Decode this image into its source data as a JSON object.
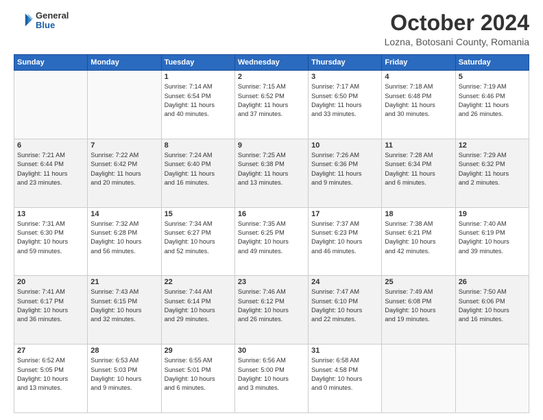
{
  "header": {
    "logo": {
      "general": "General",
      "blue": "Blue"
    },
    "title": "October 2024",
    "subtitle": "Lozna, Botosani County, Romania"
  },
  "calendar": {
    "headers": [
      "Sunday",
      "Monday",
      "Tuesday",
      "Wednesday",
      "Thursday",
      "Friday",
      "Saturday"
    ],
    "rows": [
      {
        "shaded": false,
        "cells": [
          {
            "day": "",
            "info": ""
          },
          {
            "day": "",
            "info": ""
          },
          {
            "day": "1",
            "info": "Sunrise: 7:14 AM\nSunset: 6:54 PM\nDaylight: 11 hours\nand 40 minutes."
          },
          {
            "day": "2",
            "info": "Sunrise: 7:15 AM\nSunset: 6:52 PM\nDaylight: 11 hours\nand 37 minutes."
          },
          {
            "day": "3",
            "info": "Sunrise: 7:17 AM\nSunset: 6:50 PM\nDaylight: 11 hours\nand 33 minutes."
          },
          {
            "day": "4",
            "info": "Sunrise: 7:18 AM\nSunset: 6:48 PM\nDaylight: 11 hours\nand 30 minutes."
          },
          {
            "day": "5",
            "info": "Sunrise: 7:19 AM\nSunset: 6:46 PM\nDaylight: 11 hours\nand 26 minutes."
          }
        ]
      },
      {
        "shaded": true,
        "cells": [
          {
            "day": "6",
            "info": "Sunrise: 7:21 AM\nSunset: 6:44 PM\nDaylight: 11 hours\nand 23 minutes."
          },
          {
            "day": "7",
            "info": "Sunrise: 7:22 AM\nSunset: 6:42 PM\nDaylight: 11 hours\nand 20 minutes."
          },
          {
            "day": "8",
            "info": "Sunrise: 7:24 AM\nSunset: 6:40 PM\nDaylight: 11 hours\nand 16 minutes."
          },
          {
            "day": "9",
            "info": "Sunrise: 7:25 AM\nSunset: 6:38 PM\nDaylight: 11 hours\nand 13 minutes."
          },
          {
            "day": "10",
            "info": "Sunrise: 7:26 AM\nSunset: 6:36 PM\nDaylight: 11 hours\nand 9 minutes."
          },
          {
            "day": "11",
            "info": "Sunrise: 7:28 AM\nSunset: 6:34 PM\nDaylight: 11 hours\nand 6 minutes."
          },
          {
            "day": "12",
            "info": "Sunrise: 7:29 AM\nSunset: 6:32 PM\nDaylight: 11 hours\nand 2 minutes."
          }
        ]
      },
      {
        "shaded": false,
        "cells": [
          {
            "day": "13",
            "info": "Sunrise: 7:31 AM\nSunset: 6:30 PM\nDaylight: 10 hours\nand 59 minutes."
          },
          {
            "day": "14",
            "info": "Sunrise: 7:32 AM\nSunset: 6:28 PM\nDaylight: 10 hours\nand 56 minutes."
          },
          {
            "day": "15",
            "info": "Sunrise: 7:34 AM\nSunset: 6:27 PM\nDaylight: 10 hours\nand 52 minutes."
          },
          {
            "day": "16",
            "info": "Sunrise: 7:35 AM\nSunset: 6:25 PM\nDaylight: 10 hours\nand 49 minutes."
          },
          {
            "day": "17",
            "info": "Sunrise: 7:37 AM\nSunset: 6:23 PM\nDaylight: 10 hours\nand 46 minutes."
          },
          {
            "day": "18",
            "info": "Sunrise: 7:38 AM\nSunset: 6:21 PM\nDaylight: 10 hours\nand 42 minutes."
          },
          {
            "day": "19",
            "info": "Sunrise: 7:40 AM\nSunset: 6:19 PM\nDaylight: 10 hours\nand 39 minutes."
          }
        ]
      },
      {
        "shaded": true,
        "cells": [
          {
            "day": "20",
            "info": "Sunrise: 7:41 AM\nSunset: 6:17 PM\nDaylight: 10 hours\nand 36 minutes."
          },
          {
            "day": "21",
            "info": "Sunrise: 7:43 AM\nSunset: 6:15 PM\nDaylight: 10 hours\nand 32 minutes."
          },
          {
            "day": "22",
            "info": "Sunrise: 7:44 AM\nSunset: 6:14 PM\nDaylight: 10 hours\nand 29 minutes."
          },
          {
            "day": "23",
            "info": "Sunrise: 7:46 AM\nSunset: 6:12 PM\nDaylight: 10 hours\nand 26 minutes."
          },
          {
            "day": "24",
            "info": "Sunrise: 7:47 AM\nSunset: 6:10 PM\nDaylight: 10 hours\nand 22 minutes."
          },
          {
            "day": "25",
            "info": "Sunrise: 7:49 AM\nSunset: 6:08 PM\nDaylight: 10 hours\nand 19 minutes."
          },
          {
            "day": "26",
            "info": "Sunrise: 7:50 AM\nSunset: 6:06 PM\nDaylight: 10 hours\nand 16 minutes."
          }
        ]
      },
      {
        "shaded": false,
        "cells": [
          {
            "day": "27",
            "info": "Sunrise: 6:52 AM\nSunset: 5:05 PM\nDaylight: 10 hours\nand 13 minutes."
          },
          {
            "day": "28",
            "info": "Sunrise: 6:53 AM\nSunset: 5:03 PM\nDaylight: 10 hours\nand 9 minutes."
          },
          {
            "day": "29",
            "info": "Sunrise: 6:55 AM\nSunset: 5:01 PM\nDaylight: 10 hours\nand 6 minutes."
          },
          {
            "day": "30",
            "info": "Sunrise: 6:56 AM\nSunset: 5:00 PM\nDaylight: 10 hours\nand 3 minutes."
          },
          {
            "day": "31",
            "info": "Sunrise: 6:58 AM\nSunset: 4:58 PM\nDaylight: 10 hours\nand 0 minutes."
          },
          {
            "day": "",
            "info": ""
          },
          {
            "day": "",
            "info": ""
          }
        ]
      }
    ]
  }
}
